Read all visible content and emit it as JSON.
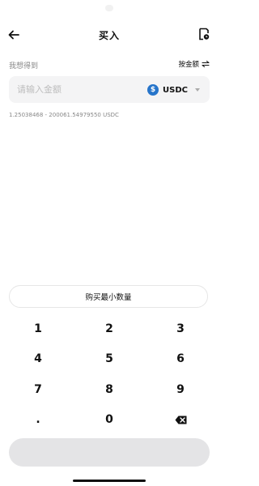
{
  "header": {
    "title": "买入",
    "back_icon": "arrow-left-icon",
    "orders_icon": "order-history-icon"
  },
  "form": {
    "want_label": "我想得到",
    "toggle_label": "按金额",
    "toggle_icon": "swap-arrows-icon",
    "amount_placeholder": "请输入金额",
    "amount_value": "",
    "currency": {
      "symbol": "$",
      "code": "USDC",
      "icon": "usdc-coin-icon",
      "color": "#2775ca"
    },
    "range_text": "1.25038468 - 200061.54979550 USDC"
  },
  "min_button_label": "购买最小数量",
  "keypad": {
    "keys": [
      "1",
      "2",
      "3",
      "4",
      "5",
      "6",
      "7",
      "8",
      "9",
      ".",
      "0"
    ],
    "delete_icon": "backspace-icon"
  },
  "confirm_button": {
    "label": "",
    "color": "#e4e4e6"
  }
}
